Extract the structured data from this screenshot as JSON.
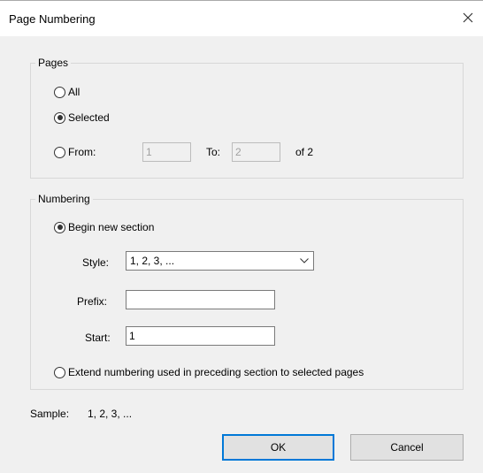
{
  "dialog": {
    "title": "Page Numbering"
  },
  "pages": {
    "legend": "Pages",
    "all_label": "All",
    "selected_label": "Selected",
    "from_label": "From:",
    "from_value": "1",
    "to_label": "To:",
    "to_value": "2",
    "of_label": "of 2",
    "selected_option": "Selected"
  },
  "numbering": {
    "legend": "Numbering",
    "begin_label": "Begin new section",
    "style_label": "Style:",
    "style_value": "1, 2, 3, ...",
    "prefix_label": "Prefix:",
    "prefix_value": "",
    "start_label": "Start:",
    "start_value": "1",
    "extend_label": "Extend numbering used in preceding section to selected pages",
    "selected_option": "Begin new section"
  },
  "sample": {
    "label": "Sample:",
    "value": "1, 2, 3, ..."
  },
  "buttons": {
    "ok": "OK",
    "cancel": "Cancel"
  },
  "colors": {
    "accent": "#0078d7",
    "background": "#f0f0f0"
  }
}
